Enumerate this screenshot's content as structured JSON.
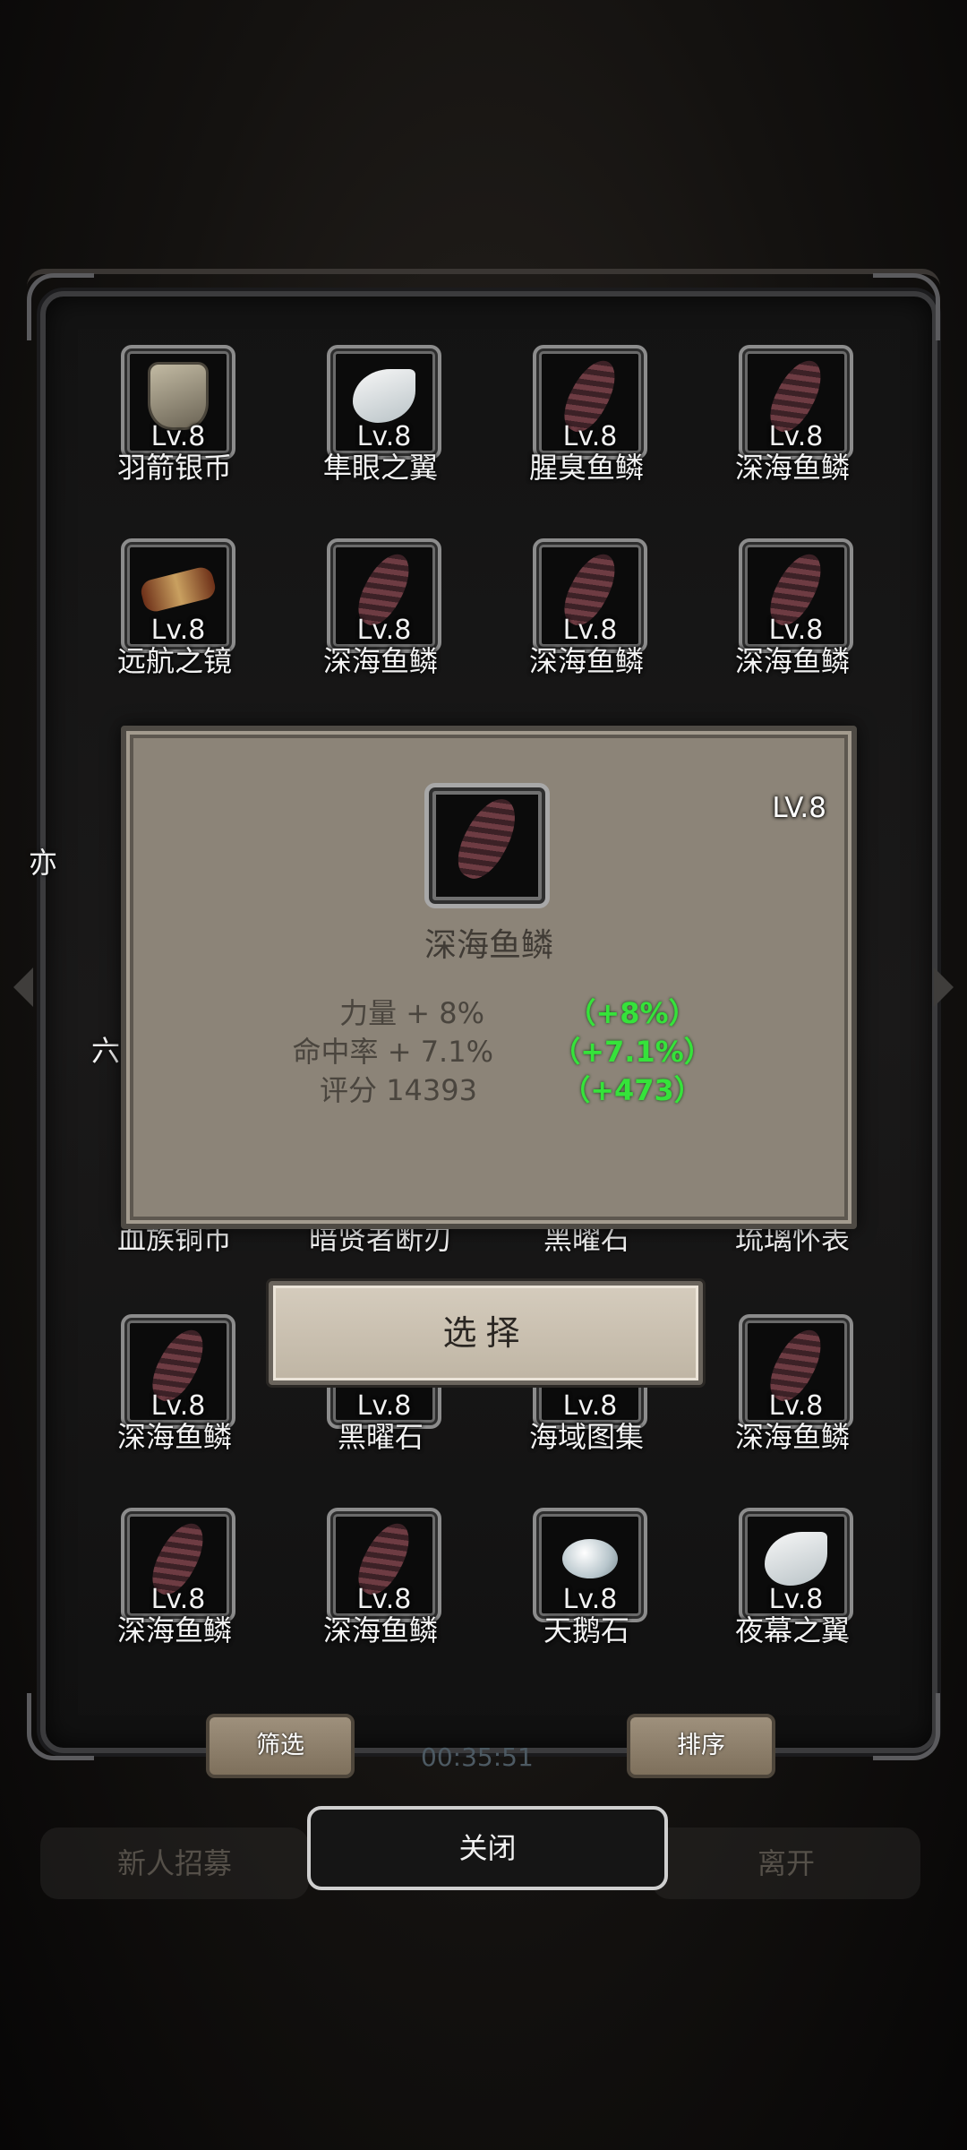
{
  "grid": {
    "rows": [
      [
        {
          "name": "羽箭银币",
          "level": "Lv.8",
          "icon": "shield-coin-icon"
        },
        {
          "name": "隼眼之翼",
          "level": "Lv.8",
          "icon": "wing-icon"
        },
        {
          "name": "腥臭鱼鳞",
          "level": "Lv.8",
          "icon": "scale-icon"
        },
        {
          "name": "深海鱼鳞",
          "level": "Lv.8",
          "icon": "scale-icon"
        }
      ],
      [
        {
          "name": "远航之镜",
          "level": "Lv.8",
          "icon": "spyglass-icon"
        },
        {
          "name": "深海鱼鳞",
          "level": "Lv.8",
          "icon": "scale-icon"
        },
        {
          "name": "深海鱼鳞",
          "level": "Lv.8",
          "icon": "scale-icon"
        },
        {
          "name": "深海鱼鳞",
          "level": "Lv.8",
          "icon": "scale-icon"
        }
      ],
      [
        {
          "name": "深海鱼鳞",
          "level": "Lv.8",
          "icon": "scale-icon"
        },
        {
          "name": "黑曜石",
          "level": "Lv.8",
          "icon": "obsidian-icon"
        },
        {
          "name": "海域图集",
          "level": "Lv.8",
          "icon": "atlas-icon"
        },
        {
          "name": "深海鱼鳞",
          "level": "Lv.8",
          "icon": "scale-icon"
        }
      ],
      [
        {
          "name": "深海鱼鳞",
          "level": "Lv.8",
          "icon": "scale-icon"
        },
        {
          "name": "深海鱼鳞",
          "level": "Lv.8",
          "icon": "scale-icon"
        },
        {
          "name": "天鹅石",
          "level": "Lv.8",
          "icon": "stone-icon"
        },
        {
          "name": "夜幕之翼",
          "level": "Lv.8",
          "icon": "wing-icon"
        }
      ]
    ],
    "partial_row_labels": [
      "血族铜币",
      "暗贤者断刃",
      "黑曜石",
      "琉璃怀表"
    ],
    "partial_side_chars": [
      "亦",
      "六"
    ]
  },
  "detail": {
    "level": "LV.8",
    "title": "深海鱼鳞",
    "icon": "scale-icon",
    "stats": [
      {
        "label": "力量 + 8%",
        "bonus": "（+8%）"
      },
      {
        "label": "命中率 + 7.1%",
        "bonus": "（+7.1%）"
      },
      {
        "label": "评分 14393",
        "bonus": "（+473）"
      }
    ]
  },
  "buttons": {
    "select": "选择",
    "filter": "筛选",
    "sort": "排序",
    "close": "关闭"
  },
  "background": {
    "left_button": "新人招募",
    "right_button": "离开",
    "timer": "00:35:51"
  },
  "colors": {
    "bonus_green": "#35e33a",
    "detail_bg": "#8c8478",
    "slot_border": "#8c8c8c"
  }
}
